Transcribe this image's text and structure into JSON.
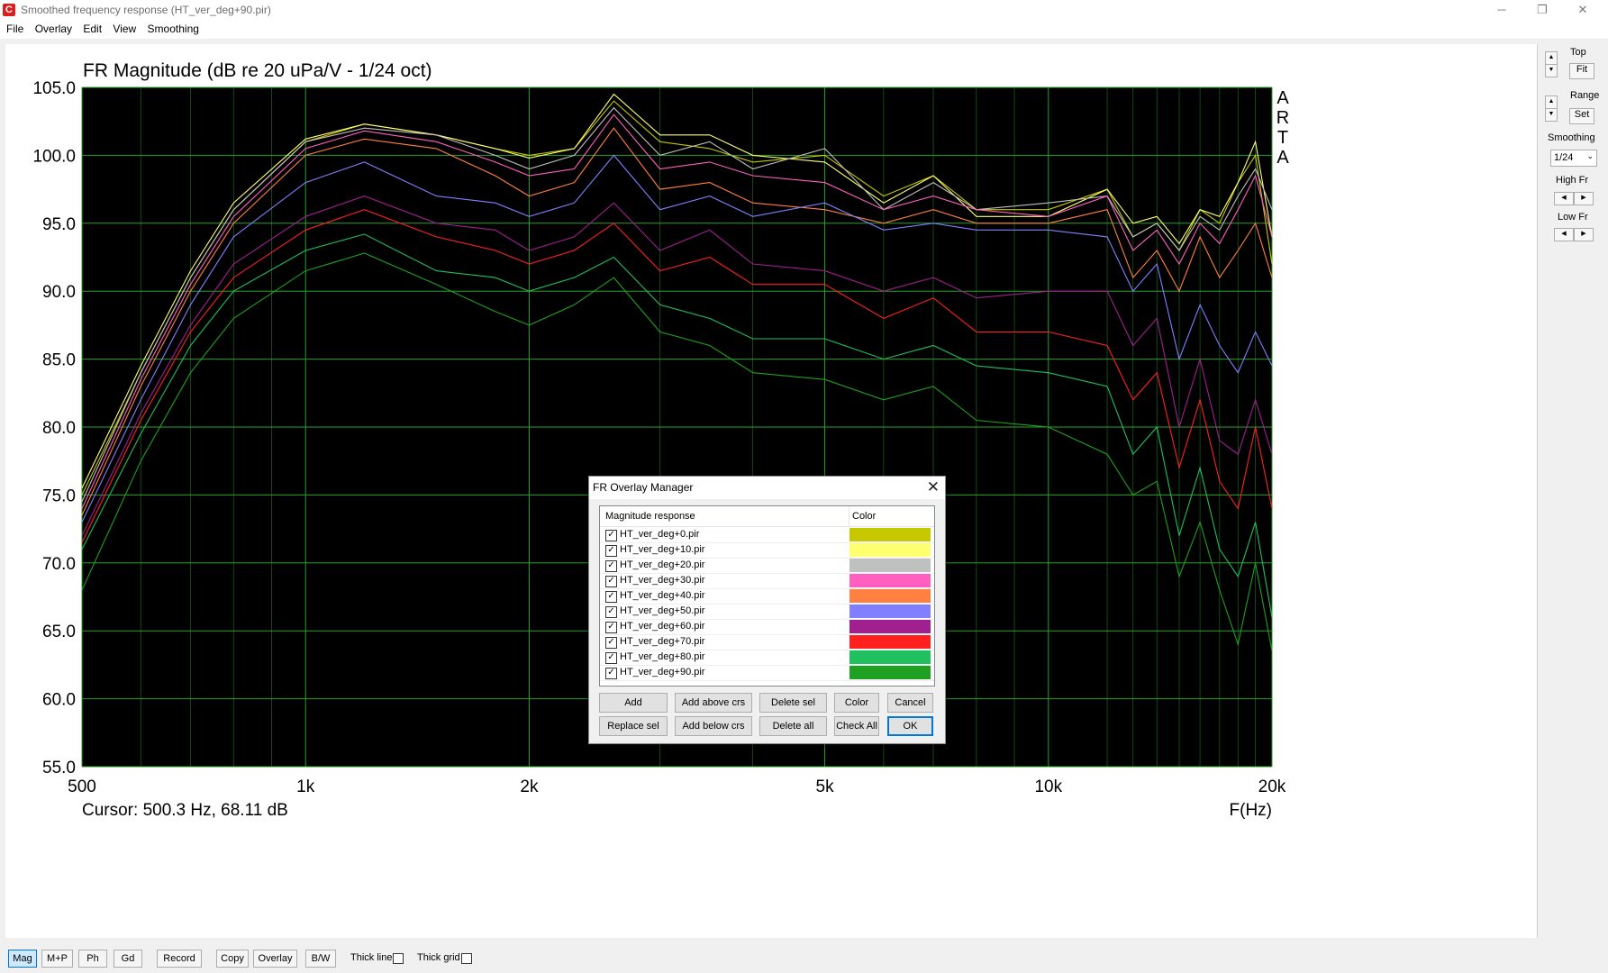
{
  "window": {
    "title": "Smoothed frequency response (HT_ver_deg+90.pir)",
    "minimize": "─",
    "restore": "❐",
    "close": "✕"
  },
  "menu": [
    "File",
    "Overlay",
    "Edit",
    "View",
    "Smoothing"
  ],
  "chart_data": {
    "type": "line",
    "title": "FR Magnitude (dB re 20 uPa/V - 1/24 oct)",
    "xlabel": "F(Hz)",
    "ylabel": "",
    "xscale": "log",
    "xlim": [
      500,
      20000
    ],
    "ylim": [
      55.0,
      105.0
    ],
    "xticks": [
      500,
      1000,
      2000,
      5000,
      10000,
      20000
    ],
    "xticklabels": [
      "500",
      "1k",
      "2k",
      "5k",
      "10k",
      "20k"
    ],
    "yticks": [
      55.0,
      60.0,
      65.0,
      70.0,
      75.0,
      80.0,
      85.0,
      90.0,
      95.0,
      100.0,
      105.0
    ],
    "yticklabels": [
      "55.0",
      "60.0",
      "65.0",
      "70.0",
      "75.0",
      "80.0",
      "85.0",
      "90.0",
      "95.0",
      "100.0",
      "105.0"
    ],
    "grid": true,
    "background": "#000000",
    "grid_color": "#1f7a1f",
    "watermark": "ARTA",
    "x": [
      500,
      600,
      700,
      800,
      1000,
      1200,
      1500,
      1800,
      2000,
      2300,
      2600,
      3000,
      3500,
      4000,
      5000,
      6000,
      7000,
      8000,
      10000,
      12000,
      13000,
      14000,
      15000,
      16000,
      17000,
      18000,
      19000,
      20000
    ],
    "series": [
      {
        "name": "HT_ver_deg+0.pir",
        "color": "#c8c800",
        "values": [
          75,
          84,
          91,
          96,
          101,
          102.3,
          101.5,
          100.5,
          100,
          100.5,
          104,
          101,
          100.5,
          99.5,
          100,
          97,
          98.5,
          96,
          96,
          97.5,
          94,
          95,
          93,
          96,
          95,
          98,
          100,
          92
        ]
      },
      {
        "name": "HT_ver_deg+10.pir",
        "color": "#ffff70",
        "values": [
          75.5,
          84.5,
          91.5,
          96.5,
          101.2,
          102.3,
          101.5,
          100.5,
          99.8,
          100.5,
          104.5,
          101.5,
          101.5,
          100,
          99.5,
          96.5,
          98.5,
          95.5,
          95.5,
          97.5,
          95,
          95.5,
          93.5,
          96,
          95.5,
          98,
          101,
          94
        ]
      },
      {
        "name": "HT_ver_deg+20.pir",
        "color": "#c0c0c0",
        "values": [
          74.5,
          84,
          91,
          96,
          101,
          102,
          101.5,
          100,
          99,
          100,
          103.5,
          100,
          101,
          99,
          100.5,
          96,
          98,
          96,
          96.5,
          97,
          94,
          95,
          93,
          95.5,
          94.5,
          97,
          99,
          96
        ]
      },
      {
        "name": "HT_ver_deg+30.pir",
        "color": "#ff60c0",
        "values": [
          74,
          83.5,
          90.5,
          95.5,
          100.5,
          101.8,
          101,
          99.5,
          98.5,
          99,
          103,
          99,
          99.5,
          98.5,
          98,
          96,
          97,
          96,
          95.5,
          97,
          93,
          94.5,
          92,
          95,
          93.5,
          96,
          98.5,
          94
        ]
      },
      {
        "name": "HT_ver_deg+40.pir",
        "color": "#ff8040",
        "values": [
          73.5,
          83,
          90,
          95,
          100,
          101.2,
          100.5,
          98.5,
          97,
          98,
          102,
          97.5,
          98,
          96.5,
          96,
          95,
          96,
          95,
          95,
          96,
          91,
          93,
          90,
          94,
          91,
          93,
          95,
          91
        ]
      },
      {
        "name": "HT_ver_deg+50.pir",
        "color": "#8080ff",
        "values": [
          73,
          82,
          89,
          94,
          98,
          99.5,
          97,
          96.5,
          95.5,
          96.5,
          100,
          96,
          97,
          95.5,
          96.5,
          94.5,
          95,
          94.5,
          94.5,
          94,
          90,
          92,
          85,
          89,
          86,
          84,
          87,
          84.5
        ]
      },
      {
        "name": "HT_ver_deg+60.pir",
        "color": "#a02090",
        "values": [
          72,
          81,
          87.5,
          92,
          95.5,
          97,
          95,
          94.5,
          93,
          94,
          96.5,
          93,
          94.5,
          92,
          91.5,
          90,
          91,
          89.5,
          90,
          90,
          86,
          88,
          80,
          85,
          79,
          78,
          82,
          78
        ]
      },
      {
        "name": "HT_ver_deg+70.pir",
        "color": "#ff2020",
        "values": [
          71.5,
          80.5,
          87,
          91,
          94.5,
          96,
          94,
          93,
          92,
          93,
          95,
          91.5,
          92.5,
          90.5,
          90.5,
          88,
          89.5,
          87,
          87,
          86,
          82,
          84,
          77,
          82,
          76,
          74,
          80,
          74
        ]
      },
      {
        "name": "HT_ver_deg+80.pir",
        "color": "#20c060",
        "values": [
          71,
          79.5,
          86,
          90,
          93,
          94.2,
          91.5,
          91,
          90,
          91,
          92.5,
          89,
          88,
          86.5,
          86.5,
          85,
          86,
          84.5,
          84,
          83,
          78,
          80,
          72,
          77,
          71,
          69,
          73,
          66
        ]
      },
      {
        "name": "HT_ver_deg+90.pir",
        "color": "#20a020",
        "values": [
          68,
          77.5,
          84,
          88,
          91.5,
          92.8,
          90.5,
          88.5,
          87.5,
          89,
          91,
          87,
          86,
          84,
          83.5,
          82,
          83,
          80.5,
          80,
          78,
          75,
          76,
          69,
          73,
          68,
          64,
          70,
          63.5
        ]
      }
    ]
  },
  "cursor_readout": "Cursor: 500.3 Hz, 68.11 dB",
  "side_panel": {
    "top_label": "Top",
    "fit_button": "Fit",
    "range_label": "Range",
    "set_button": "Set",
    "smoothing_label": "Smoothing",
    "smoothing_value": "1/24",
    "high_fr_label": "High Fr",
    "low_fr_label": "Low Fr"
  },
  "bottom_bar": {
    "buttons": [
      "Mag",
      "M+P",
      "Ph",
      "Gd",
      "Record",
      "Copy",
      "Overlay",
      "B/W"
    ],
    "active": "Mag",
    "thick_line_label": "Thick line",
    "thick_grid_label": "Thick grid"
  },
  "dialog": {
    "title": "FR Overlay Manager",
    "col_name": "Magnitude response",
    "col_color": "Color",
    "rows": [
      {
        "name": "HT_ver_deg+0.pir",
        "color": "#c8c800",
        "checked": true
      },
      {
        "name": "HT_ver_deg+10.pir",
        "color": "#ffff70",
        "checked": true
      },
      {
        "name": "HT_ver_deg+20.pir",
        "color": "#c0c0c0",
        "checked": true
      },
      {
        "name": "HT_ver_deg+30.pir",
        "color": "#ff60c0",
        "checked": true
      },
      {
        "name": "HT_ver_deg+40.pir",
        "color": "#ff8040",
        "checked": true
      },
      {
        "name": "HT_ver_deg+50.pir",
        "color": "#8080ff",
        "checked": true
      },
      {
        "name": "HT_ver_deg+60.pir",
        "color": "#a02090",
        "checked": true
      },
      {
        "name": "HT_ver_deg+70.pir",
        "color": "#ff2020",
        "checked": true
      },
      {
        "name": "HT_ver_deg+80.pir",
        "color": "#20c060",
        "checked": true
      },
      {
        "name": "HT_ver_deg+90.pir",
        "color": "#20a020",
        "checked": true
      }
    ],
    "buttons": {
      "add": "Add",
      "add_above": "Add above crs",
      "delete_sel": "Delete sel",
      "color": "Color",
      "cancel": "Cancel",
      "replace_sel": "Replace sel",
      "add_below": "Add below crs",
      "delete_all": "Delete all",
      "check_all": "Check All",
      "ok": "OK"
    }
  }
}
